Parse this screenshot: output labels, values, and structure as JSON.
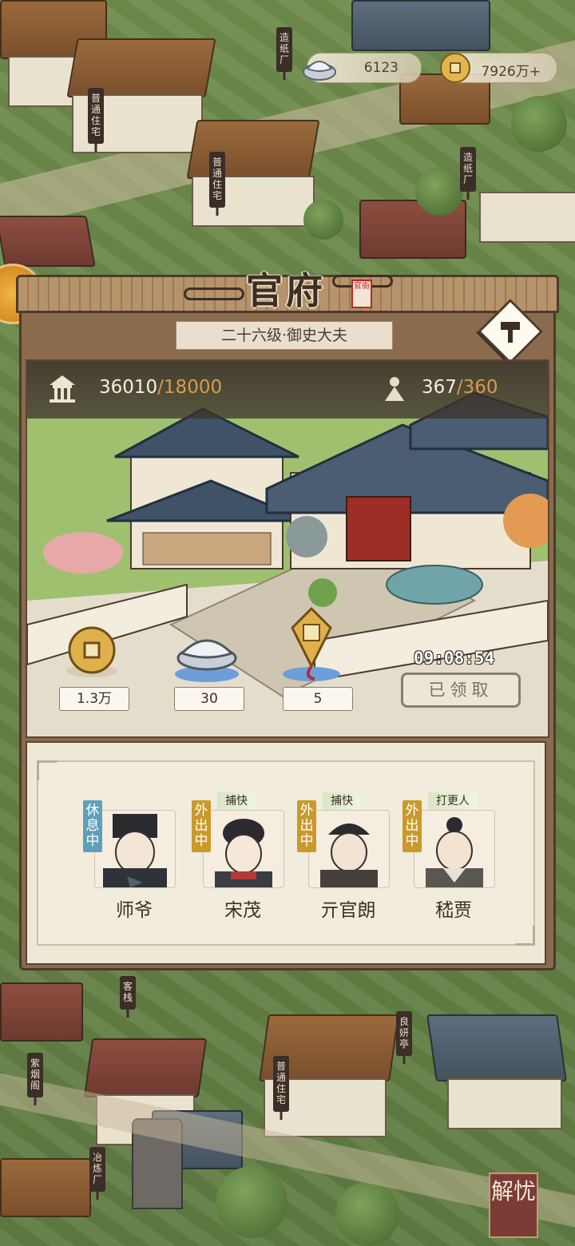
{
  "currency": {
    "silver": "6123",
    "coins": "7926万+"
  },
  "town_signs": [
    "造纸厂",
    "普通住宅",
    "普通住宅",
    "造纸厂",
    "客栈",
    "紫烟阁",
    "普通住宅",
    "冶炼厂",
    "良妍亭"
  ],
  "panel": {
    "title": "官府",
    "seal": "官衙",
    "rank": "二十六级·御史大夫",
    "capacity": {
      "current": "36010",
      "max": "/18000"
    },
    "population": {
      "current": "367",
      "max": "/360"
    },
    "rewards": [
      {
        "name": "coin",
        "amount": "1.3万"
      },
      {
        "name": "silver",
        "amount": "30"
      },
      {
        "name": "token",
        "amount": "5"
      }
    ],
    "timer": "09:08:54",
    "claim_label": "已领取"
  },
  "staff": [
    {
      "name": "师爷",
      "status": "休息中",
      "role": ""
    },
    {
      "name": "宋茂",
      "status": "外出中",
      "role": "捕快"
    },
    {
      "name": "亓官朗",
      "status": "外出中",
      "role": "捕快"
    },
    {
      "name": "嵇贾",
      "status": "外出中",
      "role": "打更人"
    }
  ],
  "corner_button": "解忧",
  "icons": [
    "silver-ingot-icon",
    "copper-coin-icon",
    "hammer-icon",
    "pavilion-icon",
    "population-icon"
  ]
}
